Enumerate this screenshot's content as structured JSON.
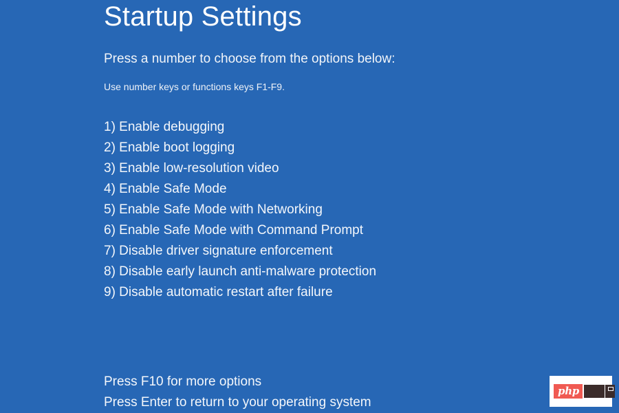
{
  "screen": {
    "background_color": "#2767b5",
    "text_color": "#f4f7fb"
  },
  "header": {
    "title": "Startup Settings",
    "subtitle": "Press a number to choose from the options below:",
    "hint": "Use number keys or functions keys F1-F9."
  },
  "options": [
    {
      "label": "1) Enable debugging"
    },
    {
      "label": "2) Enable boot logging"
    },
    {
      "label": "3) Enable low-resolution video"
    },
    {
      "label": "4) Enable Safe Mode"
    },
    {
      "label": "5) Enable Safe Mode with Networking"
    },
    {
      "label": "6) Enable Safe Mode with Command Prompt"
    },
    {
      "label": "7) Disable driver signature enforcement"
    },
    {
      "label": "8) Disable early launch anti-malware protection"
    },
    {
      "label": "9) Disable automatic restart after failure"
    }
  ],
  "footer": {
    "lines": [
      {
        "label": "Press F10 for more options"
      },
      {
        "label": "Press Enter to return to your operating system"
      }
    ]
  },
  "watermark": {
    "php_label": "php",
    "badge_color": "#f05a52",
    "mark_color": "#3b2c2a",
    "background_color": "#ffffff"
  }
}
